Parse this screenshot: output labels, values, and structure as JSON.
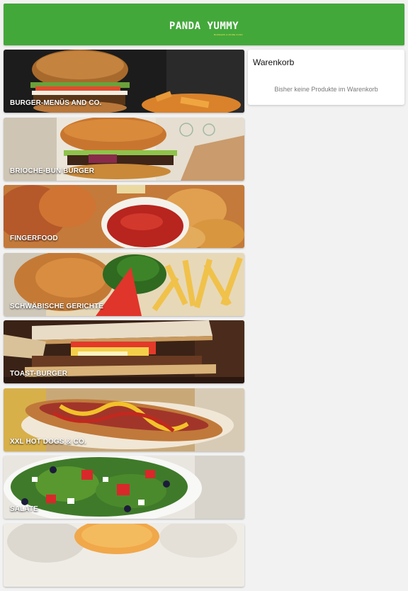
{
  "header": {
    "logo_title": "PANDA YUMMY",
    "logo_tagline": "BURGERS & MORE FOOD",
    "background": "#43a83a"
  },
  "categories": [
    {
      "label": "BURGER-MENÜS AND CO.",
      "icon": "burger-menu-photo"
    },
    {
      "label": "BRIOCHE-BUN BURGER",
      "icon": "brioche-burger-photo"
    },
    {
      "label": "FINGERFOOD",
      "icon": "fingerfood-photo"
    },
    {
      "label": "SCHWÄBISCHE GERICHTE",
      "icon": "schnitzel-fries-photo"
    },
    {
      "label": "TOAST-BURGER",
      "icon": "toast-burger-photo"
    },
    {
      "label": "XXL HOT DOGS & CO.",
      "icon": "hot-dog-photo"
    },
    {
      "label": "SALATE",
      "icon": "salad-photo"
    },
    {
      "label": "",
      "icon": "sauces-photo"
    }
  ],
  "cart": {
    "title": "Warenkorb",
    "empty_message": "Bisher keine Produkte im Warenkorb"
  }
}
